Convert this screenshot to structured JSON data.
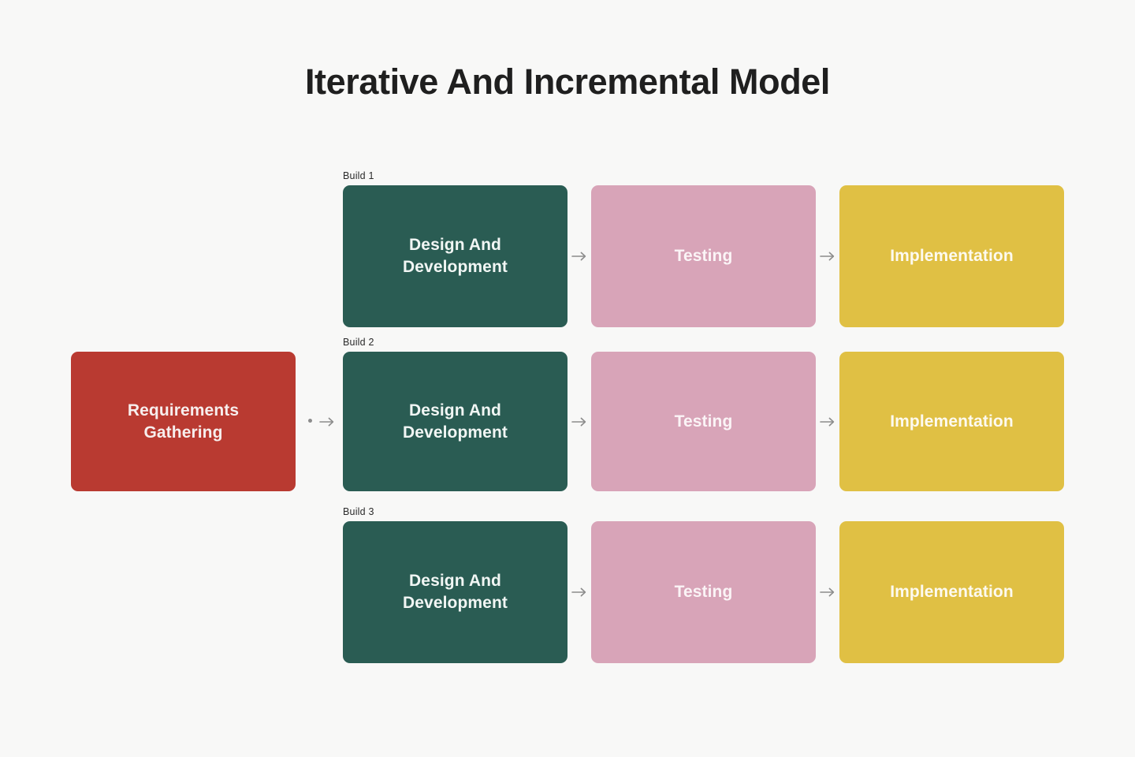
{
  "title": "Iterative And Incremental Model",
  "colors": {
    "background": "#F8F8F7",
    "title_text": "#1F1F1F",
    "start_box": "#B93A31",
    "design_box": "#2A5C53",
    "testing_box": "#D8A4B8",
    "implementation_box": "#E0C044",
    "arrow": "#8C8C8C",
    "build_label_text": "#2B2B2B",
    "box_text_light": "#F7F4F2"
  },
  "start_node": {
    "label": "Requirements\nGathering"
  },
  "stage_labels": {
    "design": "Design And\nDevelopment",
    "testing": "Testing",
    "implementation": "Implementation"
  },
  "builds": [
    {
      "build_label": "Build 1",
      "design": "Design And\nDevelopment",
      "testing": "Testing",
      "implementation": "Implementation"
    },
    {
      "build_label": "Build 2",
      "design": "Design And\nDevelopment",
      "testing": "Testing",
      "implementation": "Implementation"
    },
    {
      "build_label": "Build 3",
      "design": "Design And\nDevelopment",
      "testing": "Testing",
      "implementation": "Implementation"
    }
  ],
  "arrows": {
    "glyph": "arrow-right-icon",
    "count": 7
  }
}
